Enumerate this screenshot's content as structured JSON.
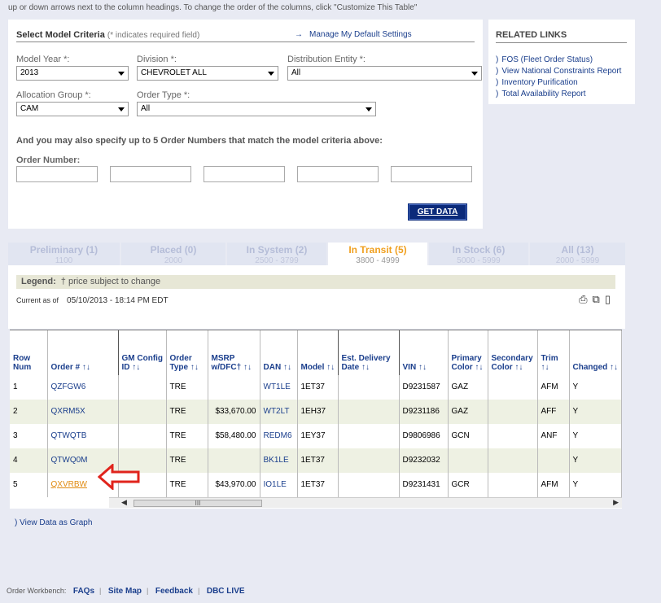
{
  "top_note": "up or down arrows next to the column headings. To change the order of the columns, click \"Customize This Table\"",
  "criteria": {
    "title": "Select Model Criteria",
    "required_note": "(* indicates required field)",
    "manage_link": "Manage My Default Settings",
    "model_year_label": "Model Year *:",
    "model_year_value": "2013",
    "division_label": "Division *:",
    "division_value": "CHEVROLET ALL",
    "distribution_label": "Distribution Entity *:",
    "distribution_value": "All",
    "allocation_label": "Allocation Group *:",
    "allocation_value": "CAM",
    "order_type_label": "Order Type *:",
    "order_type_value": "All",
    "order_numbers_prompt": "And you may also specify up to 5 Order Numbers that match the model criteria above:",
    "order_number_label": "Order Number:",
    "get_data_label": "GET DATA"
  },
  "related": {
    "title": "RELATED LINKS",
    "bullet": ")",
    "links": [
      "FOS (Fleet Order Status)",
      "View National Constraints Report",
      "Inventory Purification",
      "Total Availability Report"
    ]
  },
  "tabs": [
    {
      "name": "Preliminary",
      "count": "(1)",
      "range": "1100"
    },
    {
      "name": "Placed",
      "count": "(0)",
      "range": "2000"
    },
    {
      "name": "In System",
      "count": "(2)",
      "range": "2500 - 3799"
    },
    {
      "name": "In Transit",
      "count": "(5)",
      "range": "3800 - 4999"
    },
    {
      "name": "In Stock",
      "count": "(6)",
      "range": "5000 - 5999"
    },
    {
      "name": "All",
      "count": "(13)",
      "range": "2000 - 5999"
    }
  ],
  "legend": {
    "label": "Legend:",
    "text": "† price subject to change"
  },
  "current": {
    "label": "Current as of",
    "timestamp": "05/10/2013 - 18:14 PM EDT"
  },
  "toolbar_icons": [
    "print-icon",
    "copy-icon",
    "pin-icon"
  ],
  "table": {
    "headers": [
      "Row Num",
      "Order # ↑↓",
      "GM Config ID ↑↓",
      "Order Type ↑↓",
      "MSRP w/DFC† ↑↓",
      "DAN ↑↓",
      "Model ↑↓",
      "Est. Delivery Date ↑↓",
      "VIN ↑↓",
      "Primary Color ↑↓",
      "Secondary Color ↑↓",
      "Trim ↑↓",
      "Changed ↑↓"
    ],
    "rows": [
      [
        "1",
        "QZFGW6",
        "",
        "TRE",
        "",
        "WT1LE",
        "1ET37",
        "",
        "D9231587",
        "GAZ",
        "",
        "AFM",
        "Y"
      ],
      [
        "2",
        "QXRM5X",
        "",
        "TRE",
        "$33,670.00",
        "WT2LT",
        "1EH37",
        "",
        "D9231186",
        "GAZ",
        "",
        "AFF",
        "Y"
      ],
      [
        "3",
        "QTWQTB",
        "",
        "TRE",
        "$58,480.00",
        "REDM6",
        "1EY37",
        "",
        "D9806986",
        "GCN",
        "",
        "ANF",
        "Y"
      ],
      [
        "4",
        "QTWQ0M",
        "",
        "TRE",
        "",
        "BK1LE",
        "1ET37",
        "",
        "D9232032",
        "",
        "",
        "",
        "Y"
      ],
      [
        "5",
        "QXVRBW",
        "",
        "TRE",
        "$43,970.00",
        "IO1LE",
        "1ET37",
        "",
        "D9231431",
        "GCR",
        "",
        "AFM",
        "Y"
      ]
    ]
  },
  "scroll_thumb": "III",
  "graph_link": ") View Data as Graph",
  "footer": {
    "label": "Order Workbench:",
    "links": [
      "FAQs",
      "Site Map",
      "Feedback",
      "DBC LIVE"
    ]
  },
  "colors": {
    "link": "#1a3e8c",
    "active_tab": "#f0a020",
    "arrow": "#e0241c"
  }
}
